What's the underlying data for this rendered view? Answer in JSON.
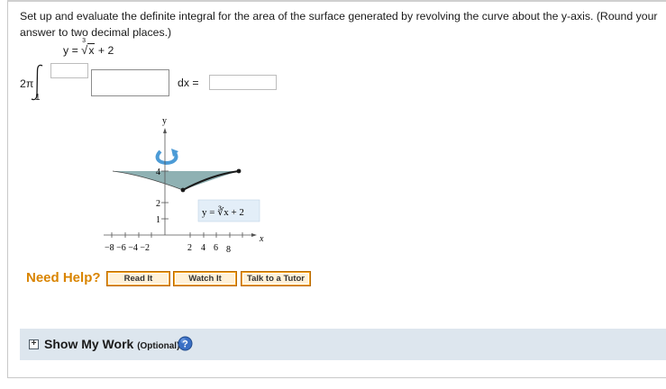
{
  "question": {
    "text": "Set up and evaluate the definite integral for the area of the surface generated by revolving the curve about the y-axis. (Round your answer to two decimal places.)"
  },
  "function": {
    "lhs": "y =",
    "root_index": "3",
    "radicand": "x",
    "rest": "+ 2"
  },
  "integral": {
    "coefficient": "2π",
    "lower_limit": "1",
    "upper_limit_value": "",
    "integrand_value": "",
    "dx_label": "dx  =",
    "answer_value": ""
  },
  "graph": {
    "y_axis_label": "y",
    "x_axis_label": "x",
    "y_tick_labels": [
      "4",
      "2",
      "1"
    ],
    "x_tick_labels_neg": "−8 −6 −4 −2",
    "x_tick_labels_pos": [
      "2",
      "4",
      "6",
      "8"
    ],
    "curve_label": "y = ∛x + 2",
    "colors": {
      "surface": "#8fb1b3",
      "label_box": "#e3eef8",
      "rotation_arrow": "#4c9bd6"
    }
  },
  "help": {
    "title": "Need Help?",
    "buttons": [
      "Read It",
      "Watch It",
      "Talk to a Tutor"
    ]
  },
  "show_work": {
    "expand_symbol": "+",
    "label": "Show My Work",
    "optional": "(Optional)",
    "help_icon": "question-circle-icon"
  }
}
